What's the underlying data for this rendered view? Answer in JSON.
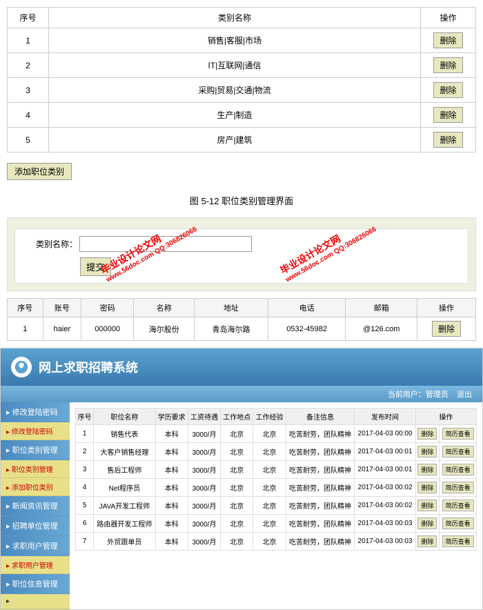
{
  "table1": {
    "headers": [
      "序号",
      "类别名称",
      "操作"
    ],
    "rows": [
      {
        "num": "1",
        "name": "销售|客服|市场"
      },
      {
        "num": "2",
        "name": "IT|互联网|通信"
      },
      {
        "num": "3",
        "name": "采购|贸易|交通|物流"
      },
      {
        "num": "4",
        "name": "生产|制造"
      },
      {
        "num": "5",
        "name": "房产|建筑"
      }
    ],
    "delete_label": "删除",
    "add_label": "添加职位类别"
  },
  "caption1": "图 5-12 职位类别管理界面",
  "search": {
    "label": "类别名称：",
    "submit": "提交"
  },
  "table2": {
    "headers": [
      "序号",
      "账号",
      "密码",
      "名称",
      "地址",
      "电话",
      "邮箱",
      "操作"
    ],
    "rows": [
      {
        "num": "1",
        "account": "haier",
        "password": "000000",
        "name": "海尔股份",
        "address": "青岛海尔路",
        "phone": "0532-45982",
        "email": "@126.com"
      }
    ],
    "delete_label": "删除"
  },
  "watermark": {
    "line1": "毕业设计论文网",
    "line2": "www.56doc.com  QQ:306826066"
  },
  "system": {
    "title": "网上求职招聘系统",
    "subheader_user": "当前用户：管理员",
    "subheader_exit": "退出",
    "sidebar": {
      "groups": [
        {
          "title": "修改登陆密码",
          "items": [
            {
              "label": "修改登陆密码",
              "red": true
            }
          ]
        },
        {
          "title": "职位类别管理",
          "items": [
            {
              "label": "职位类别管理",
              "red": true
            },
            {
              "label": "添加职位类别",
              "red": true
            }
          ]
        },
        {
          "title": "新闻资讯管理",
          "items": []
        },
        {
          "title": "招聘单位管理",
          "items": []
        },
        {
          "title": "求职用户管理",
          "items": [
            {
              "label": "求职用户管理",
              "red": true
            }
          ]
        },
        {
          "title": "职位信息管理",
          "items": [
            {
              "label": "",
              "red": false
            }
          ]
        }
      ]
    },
    "table": {
      "headers": [
        "序号",
        "职位名称",
        "学历要求",
        "工资待遇",
        "工作地点",
        "工作经验",
        "备注信息",
        "发布时间",
        "操作"
      ],
      "rows": [
        {
          "num": "1",
          "pos": "销售代表",
          "edu": "本科",
          "salary": "3000/月",
          "loc": "北京",
          "exp": "北京",
          "note": "吃苦耐劳，团队精神",
          "date": "2017-04-03 00:00"
        },
        {
          "num": "2",
          "pos": "大客户销售经理",
          "edu": "本科",
          "salary": "3000/月",
          "loc": "北京",
          "exp": "北京",
          "note": "吃苦耐劳，团队精神",
          "date": "2017-04-03 00:01"
        },
        {
          "num": "3",
          "pos": "售后工程师",
          "edu": "本科",
          "salary": "3000/月",
          "loc": "北京",
          "exp": "北京",
          "note": "吃苦耐劳，团队精神",
          "date": "2017-04-03 00:01"
        },
        {
          "num": "4",
          "pos": "Net程序员",
          "edu": "本科",
          "salary": "3000/月",
          "loc": "北京",
          "exp": "北京",
          "note": "吃苦耐劳，团队精神",
          "date": "2017-04-03 00:02"
        },
        {
          "num": "5",
          "pos": "JAVA开发工程师",
          "edu": "本科",
          "salary": "3000/月",
          "loc": "北京",
          "exp": "北京",
          "note": "吃苦耐劳，团队精神",
          "date": "2017-04-03 00:02"
        },
        {
          "num": "6",
          "pos": "路由器开发工程师",
          "edu": "本科",
          "salary": "3000/月",
          "loc": "北京",
          "exp": "北京",
          "note": "吃苦耐劳，团队精神",
          "date": "2017-04-03 00:03"
        },
        {
          "num": "7",
          "pos": "外贸跟单员",
          "edu": "本科",
          "salary": "3000/月",
          "loc": "北京",
          "exp": "北京",
          "note": "吃苦耐劳，团队精神",
          "date": "2017-04-03 00:03"
        }
      ],
      "action_delete": "删除",
      "action_view": "简历查看"
    }
  }
}
